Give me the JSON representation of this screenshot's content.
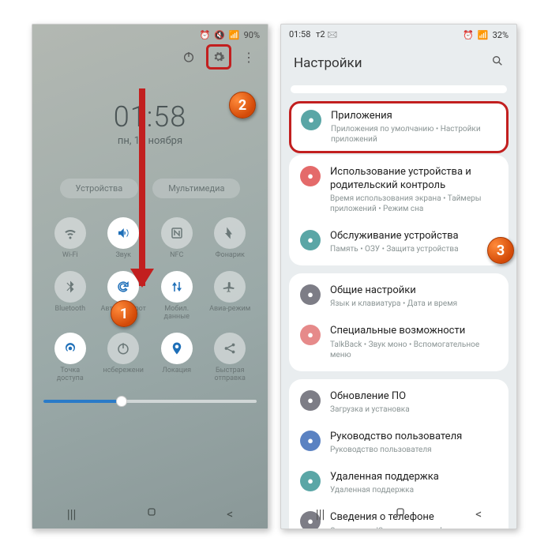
{
  "left": {
    "status": {
      "time": "",
      "battery": "90%"
    },
    "clock": {
      "time": "01:58",
      "date": "пн, 15 ноября"
    },
    "pills": [
      "Устройства",
      "Мультимедиа"
    ],
    "tiles": [
      {
        "label": "Wi-Fi",
        "icon": "wifi",
        "active": false
      },
      {
        "label": "Звук",
        "icon": "sound",
        "active": true
      },
      {
        "label": "NFC",
        "icon": "nfc",
        "active": false
      },
      {
        "label": "Фонарик",
        "icon": "flash",
        "active": false
      },
      {
        "label": "Bluetooth",
        "icon": "bt",
        "active": false
      },
      {
        "label": "Авто поворот",
        "icon": "rotate",
        "active": true
      },
      {
        "label": "Мобил. данные",
        "icon": "data",
        "active": true
      },
      {
        "label": "Авиа-режим",
        "icon": "plane",
        "active": false
      },
      {
        "label": "Точка доступа",
        "icon": "hotspot",
        "active": true
      },
      {
        "label": "нсбережени",
        "icon": "power",
        "active": false
      },
      {
        "label": "Локация",
        "icon": "location",
        "active": true
      },
      {
        "label": "Быстрая отправка",
        "icon": "share",
        "active": false
      }
    ]
  },
  "right": {
    "status": {
      "time": "01:58",
      "net": "т2",
      "battery": "32%"
    },
    "header": "Настройки",
    "groups": [
      [
        {
          "icon": "#e46a6a",
          "title": "Использование устройства и родительский контроль",
          "sub": "Время использования экрана • Таймеры приложений • Режим сна"
        },
        {
          "icon": "#5aa6a6",
          "title": "Обслуживание устройства",
          "sub": "Память • ОЗУ • Защита устройства"
        },
        {
          "icon": "#5aa6a6",
          "title": "Приложения",
          "sub": "Приложения по умолчанию • Настройки приложений",
          "hl": true
        }
      ],
      [
        {
          "icon": "#7d7d86",
          "title": "Общие настройки",
          "sub": "Язык и клавиатура • Дата и время"
        },
        {
          "icon": "#e68a8a",
          "title": "Специальные возможности",
          "sub": "TalkBack • Звук моно • Вспомогательное меню"
        }
      ],
      [
        {
          "icon": "#7d7d86",
          "title": "Обновление ПО",
          "sub": "Загрузка и установка"
        },
        {
          "icon": "#5a82c2",
          "title": "Руководство пользователя",
          "sub": "Руководство пользователя"
        },
        {
          "icon": "#5aa6a6",
          "title": "Удаленная поддержка",
          "sub": "Удаленная поддержка"
        },
        {
          "icon": "#7d7d86",
          "title": "Сведения о телефоне",
          "sub": "Состояние • Юридическая информация • Имя телефона"
        }
      ]
    ]
  },
  "badges": [
    "1",
    "2",
    "3"
  ]
}
